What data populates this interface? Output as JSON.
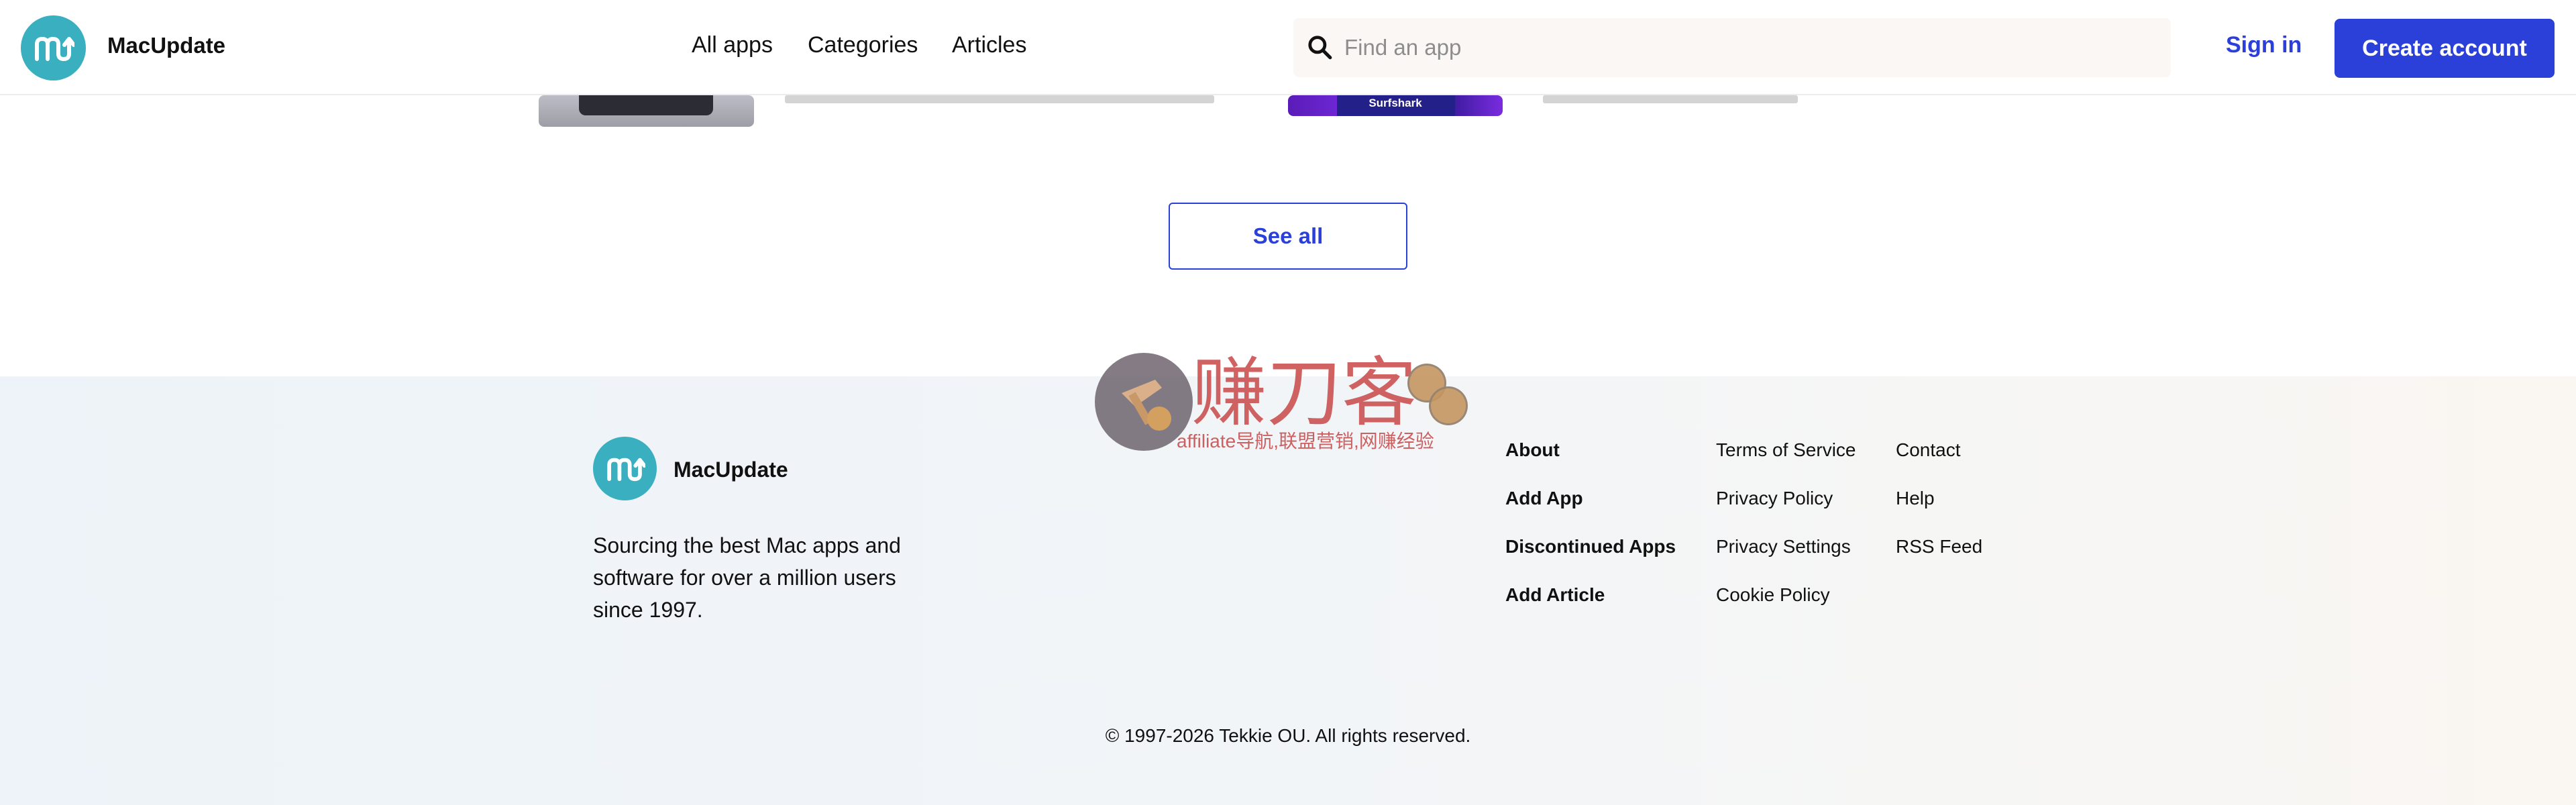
{
  "header": {
    "brand": "MacUpdate",
    "nav": [
      "All apps",
      "Categories",
      "Articles"
    ],
    "search_placeholder": "Find an app",
    "signin_label": "Sign in",
    "create_label": "Create account"
  },
  "content": {
    "surfshark_label": "Surfshark",
    "see_all_label": "See all"
  },
  "footer": {
    "brand": "MacUpdate",
    "tagline": "Sourcing the best Mac apps and software for over a million users since 1997.",
    "col1": [
      "About",
      "Add App",
      "Discontinued Apps",
      "Add Article"
    ],
    "col2": [
      "Terms of Service",
      "Privacy Policy",
      "Privacy Settings",
      "Cookie Policy"
    ],
    "col3": [
      "Contact",
      "Help",
      "RSS Feed"
    ],
    "copyright": "© 1997-2026 Tekkie OU. All rights reserved."
  },
  "watermark": {
    "title": "赚刀客",
    "subtitle": "affiliate导航,联盟营销,网赚经验"
  },
  "colors": {
    "accent": "#2b3fd9",
    "logo": "#3aafbf"
  }
}
